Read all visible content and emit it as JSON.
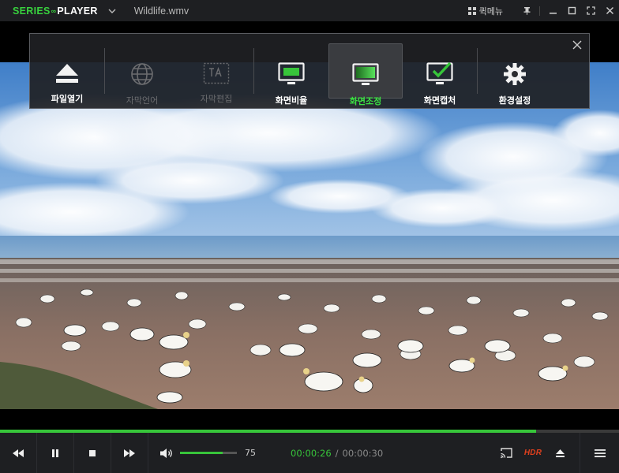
{
  "app": {
    "logo_left": "SERIES",
    "logo_link": "∞",
    "logo_right": "PLAYER",
    "file_title": "Wildlife.wmv",
    "quick_menu_label": "퀵메뉴"
  },
  "overlay_menu": {
    "items": [
      {
        "label": "파일열기",
        "icon": "eject-icon",
        "state": "normal"
      },
      {
        "label": "자막언어",
        "icon": "globe-icon",
        "state": "disabled"
      },
      {
        "label": "자막편집",
        "icon": "subtitle-edit-icon",
        "state": "disabled"
      },
      {
        "label": "화면비율",
        "icon": "monitor-icon",
        "state": "normal"
      },
      {
        "label": "화면조정",
        "icon": "monitor-adjust-icon",
        "state": "active"
      },
      {
        "label": "화면캡처",
        "icon": "monitor-check-icon",
        "state": "normal"
      },
      {
        "label": "환경설정",
        "icon": "gear-icon",
        "state": "normal"
      }
    ]
  },
  "playback": {
    "progress": 0.866,
    "volume": 75,
    "volume_label": "75",
    "current_time": "00:00:26",
    "separator": "/",
    "total_time": "00:00:30"
  },
  "badges": {
    "hdr": "HDR"
  },
  "colors": {
    "accent": "#37c53a",
    "hdr": "#e0401e",
    "bar_bg": "#1e1f22"
  }
}
